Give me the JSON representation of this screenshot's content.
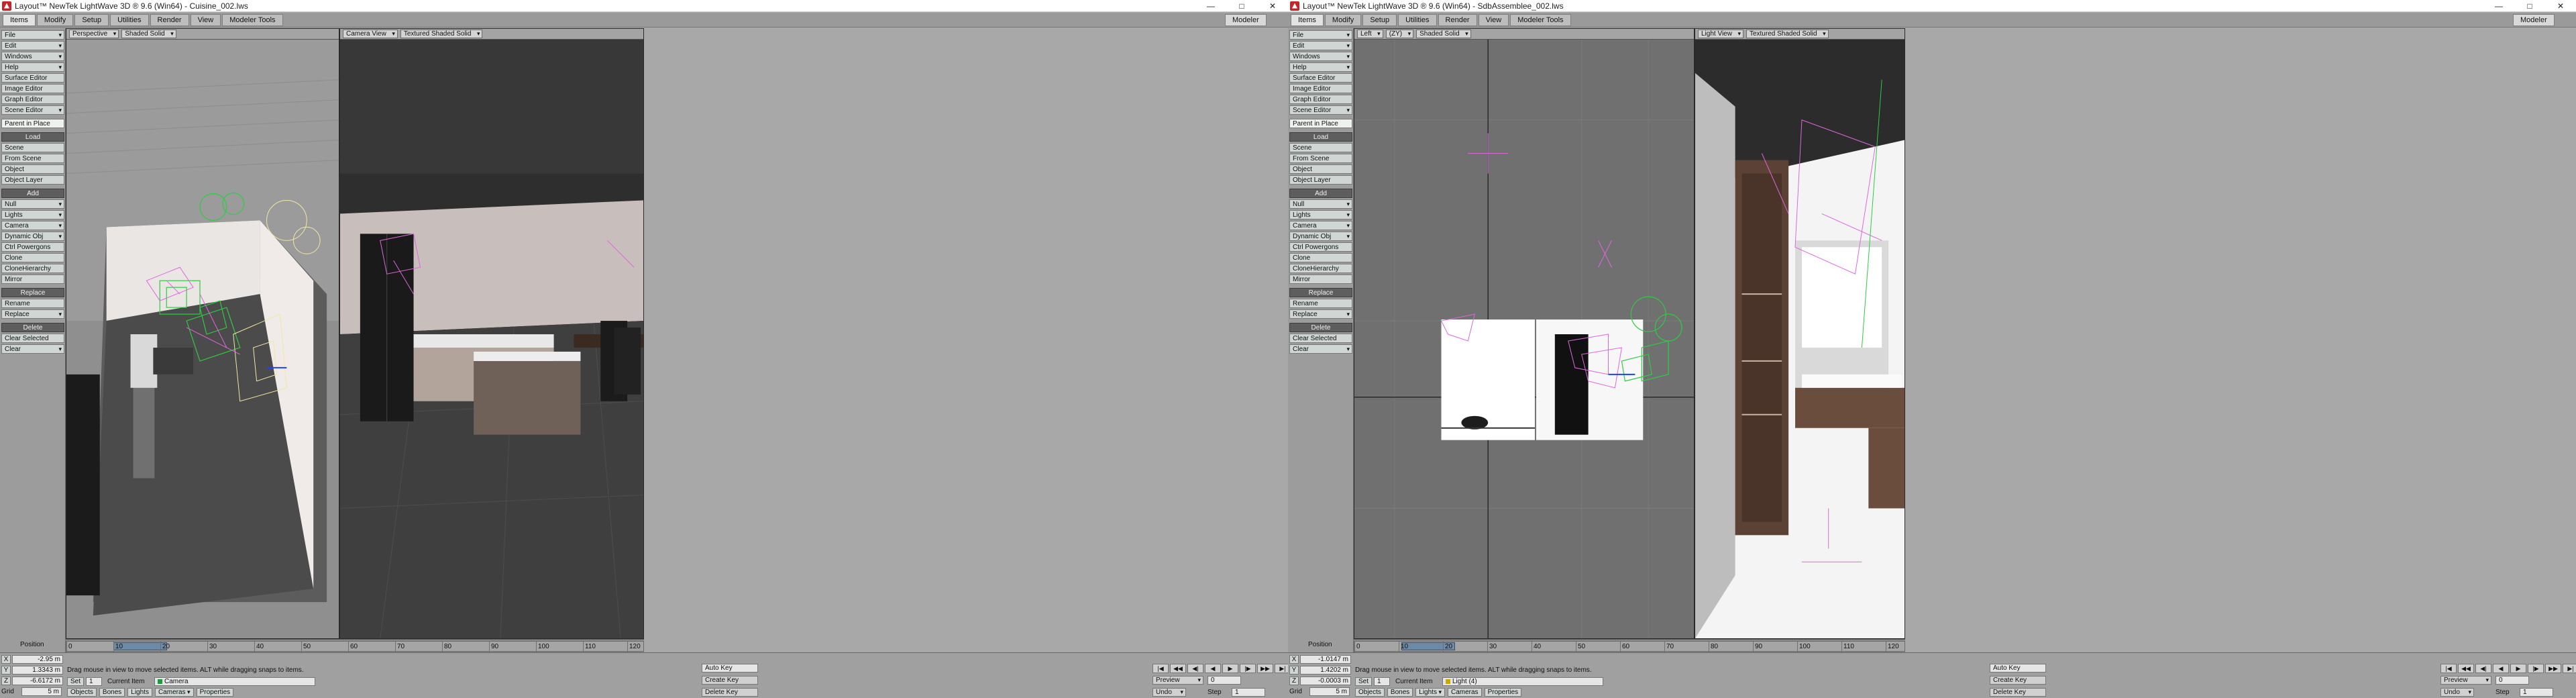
{
  "windows": [
    {
      "title": "Layout™ NewTek LightWave 3D ® 9.6  (Win64) - Cuisine_002.lws",
      "controls": [
        "—",
        "□",
        "✕"
      ],
      "tabs": [
        "Items",
        "Modify",
        "Setup",
        "Utilities",
        "Render",
        "View",
        "Modeler Tools"
      ],
      "modeler_label": "Modeler",
      "toolbar": {
        "top_buttons": [
          "File",
          "Edit",
          "Windows",
          "Help",
          "Surface Editor",
          "Image Editor",
          "Graph Editor",
          "Scene Editor"
        ],
        "parent_btn": "Parent in Place",
        "load_header": "Load",
        "load_items": [
          "Scene",
          "From Scene",
          "Object",
          "Object Layer"
        ],
        "add_header": "Add",
        "add_items": [
          "Null",
          "Lights",
          "Camera",
          "Dynamic Obj",
          "Ctrl Powergons",
          "Clone",
          "CloneHierarchy",
          "Mirror"
        ],
        "replace_header": "Replace",
        "replace_items": [
          "Rename",
          "Replace"
        ],
        "delete_header": "Delete",
        "delete_items": [
          "Clear Selected",
          "Clear"
        ]
      },
      "viewports": [
        {
          "view": "Perspective",
          "mode": "Shaded Solid"
        },
        {
          "view": "Camera View",
          "mode": "Textured Shaded Solid"
        }
      ],
      "timeline_ticks": [
        "0",
        "10",
        "20",
        "30",
        "40",
        "50",
        "60",
        "70",
        "80",
        "90",
        "100",
        "110",
        "120"
      ],
      "position_label": "Position",
      "coords": {
        "x": "-2.95 m",
        "y": "1.3343 m",
        "z": "-6.6172 m",
        "grid": "5 m"
      },
      "grid_label": "Grid",
      "status_msg": "Drag mouse in view to move selected items. ALT while dragging snaps to items.",
      "set_label": "Set",
      "set_value": "1",
      "current_item_label": "Current Item",
      "current_item": "Camera",
      "bottom_tabs": [
        "Objects",
        "Bones",
        "Lights",
        "Cameras",
        "Properties"
      ],
      "auto_key": "Auto Key",
      "create_key": "Create Key",
      "delete_key": "Delete Key",
      "preview": "Preview",
      "undo": "Undo",
      "step_label": "Step",
      "step_value": "1",
      "frame_value": "0"
    },
    {
      "title": "Layout™ NewTek LightWave 3D ® 9.6  (Win64) - SdbAssemblee_002.lws",
      "controls": [
        "—",
        "□",
        "✕"
      ],
      "tabs": [
        "Items",
        "Modify",
        "Setup",
        "Utilities",
        "Render",
        "View",
        "Modeler Tools"
      ],
      "modeler_label": "Modeler",
      "toolbar": {
        "top_buttons": [
          "File",
          "Edit",
          "Windows",
          "Help",
          "Surface Editor",
          "Image Editor",
          "Graph Editor",
          "Scene Editor"
        ],
        "parent_btn": "Parent in Place",
        "load_header": "Load",
        "load_items": [
          "Scene",
          "From Scene",
          "Object",
          "Object Layer"
        ],
        "add_header": "Add",
        "add_items": [
          "Null",
          "Lights",
          "Camera",
          "Dynamic Obj",
          "Ctrl Powergons",
          "Clone",
          "CloneHierarchy",
          "Mirror"
        ],
        "replace_header": "Replace",
        "replace_items": [
          "Rename",
          "Replace"
        ],
        "delete_header": "Delete",
        "delete_items": [
          "Clear Selected",
          "Clear"
        ]
      },
      "viewports": [
        {
          "view": "Left",
          "view2": "(ZY)",
          "mode": "Shaded Solid"
        },
        {
          "view": "Light View",
          "mode": "Textured Shaded Solid"
        }
      ],
      "timeline_ticks": [
        "0",
        "10",
        "20",
        "30",
        "40",
        "50",
        "60",
        "70",
        "80",
        "90",
        "100",
        "110",
        "120"
      ],
      "position_label": "Position",
      "coords": {
        "x": "-1.0147 m",
        "y": "1.4202 m",
        "z": "-0.0003 m",
        "grid": "5 m"
      },
      "grid_label": "Grid",
      "status_msg": "Drag mouse in view to move selected items. ALT while dragging snaps to items.",
      "set_label": "Set",
      "set_value": "1",
      "current_item_label": "Current Item",
      "current_item": "Light (4)",
      "bottom_tabs": [
        "Objects",
        "Bones",
        "Lights",
        "Cameras",
        "Properties"
      ],
      "auto_key": "Auto Key",
      "create_key": "Create Key",
      "delete_key": "Delete Key",
      "preview": "Preview",
      "undo": "Undo",
      "step_label": "Step",
      "step_value": "1",
      "frame_value": "0"
    }
  ],
  "colors": {
    "ui_gray": "#a8a8a8",
    "selection_green": "#2ecc40",
    "light_magenta": "#e066e0",
    "slider_blue": "#6f8aa6"
  }
}
